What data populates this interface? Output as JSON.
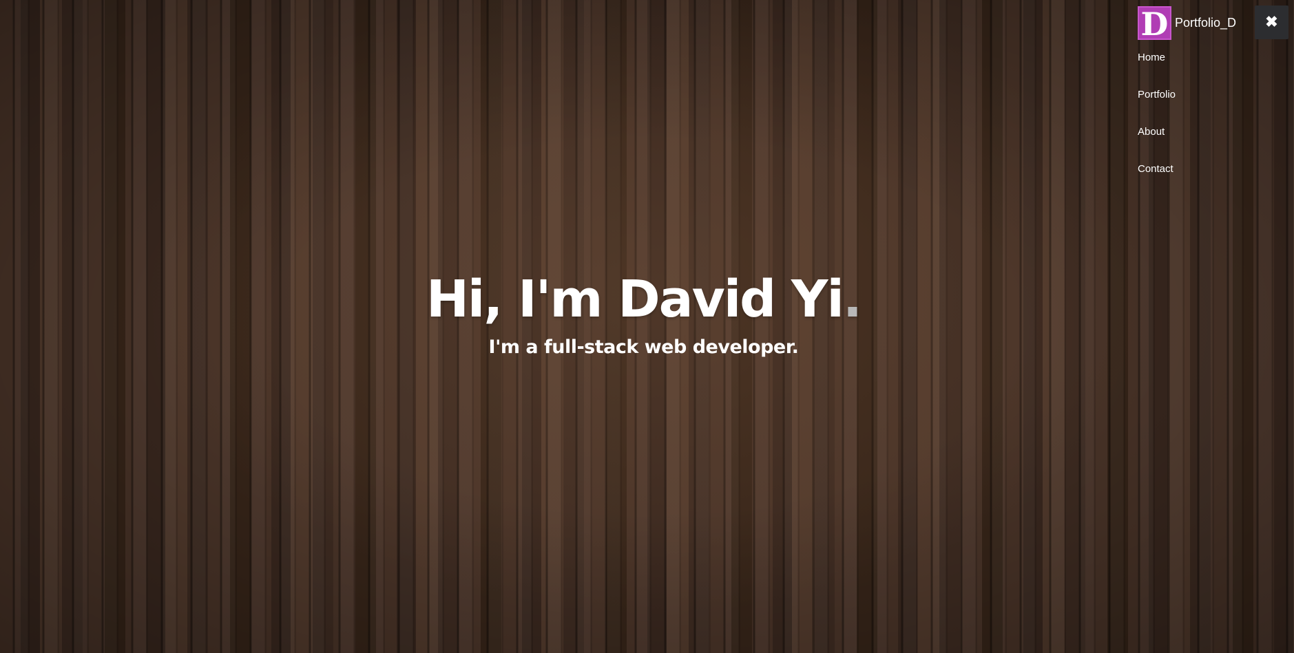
{
  "hero": {
    "title_main": "Hi, I'm David Yi",
    "title_dot": ".",
    "subtitle": "I'm a full-stack web developer."
  },
  "menu": {
    "logo_letter": "D",
    "brand_name": "Portfolio_D",
    "items": [
      {
        "label": "Home"
      },
      {
        "label": "Portfolio"
      },
      {
        "label": "About"
      },
      {
        "label": "Contact"
      }
    ],
    "close_icon": "✖"
  },
  "colors": {
    "logo_bg": "#b03db4",
    "close_bg": "#2c2d30",
    "background": "#3e2c22"
  }
}
